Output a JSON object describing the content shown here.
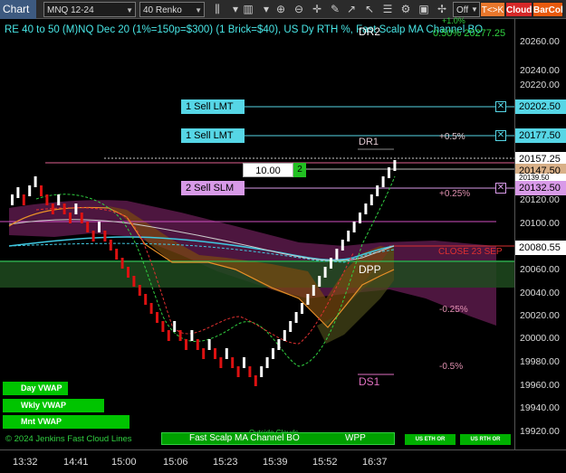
{
  "toolbar": {
    "chart_tab": "Chart",
    "instrument": "MNQ 12-24",
    "bar_type": "40 Renko",
    "toggle_off": "Off",
    "tk_button": "T<>K",
    "cloud_button": "Cloud",
    "barcol_button": "BarCol",
    "icons": [
      "bars-icon",
      "dropdown-icon",
      "zoom-in-icon",
      "zoom-out-icon",
      "crosshair-icon",
      "draw-pen-icon",
      "arrow-icon",
      "list-icon",
      "strategy-icon",
      "settings-icon"
    ]
  },
  "header": {
    "text": "RE 40 to 50 (M)NQ Dec 20 (1%=150p=$300) (1 Brick=$40), US Dy RTH %, Fast Scalp MA Channel BO",
    "dr2_label": "DR2",
    "top_right_pct": "0.50% 20277.25",
    "top_right_pct_small": "+1.0%"
  },
  "orders": {
    "sell_lmt_1": "1 Sell LMT",
    "sell_lmt_1_price": "20202.50",
    "sell_lmt_2": "1 Sell LMT",
    "sell_lmt_2_price": "20177.50",
    "sell_slm": "2 Sell SLM",
    "sell_slm_price": "20132.50",
    "qty_value": "10.00",
    "qty_count": "2"
  },
  "levels": {
    "dr1": "DR1",
    "plus_half_pct": "+0.5%",
    "plus_quarter_pct": "+0.25%",
    "close_label": "CLOSE 23 SEP",
    "dpp": "DPP",
    "minus_quarter_pct": "-0.25%",
    "minus_half_pct": "-0.5%",
    "ds1": "DS1"
  },
  "price_boxes": {
    "last": "20157.25",
    "entry": "20147.50",
    "hidden": "20139.50",
    "close": "20080.55"
  },
  "yaxis": [
    "20260.00",
    "20240.00",
    "20220.00",
    "20160.00",
    "20120.00",
    "20100.00",
    "20060.00",
    "20040.00",
    "20020.00",
    "20000.00",
    "19980.00",
    "19960.00",
    "19940.00",
    "19920.00"
  ],
  "xaxis": [
    "13:32",
    "14:41",
    "15:00",
    "15:06",
    "15:23",
    "15:39",
    "15:52",
    "16:37"
  ],
  "buttons": {
    "day_vwap": "Day VWAP",
    "wkly_vwap": "Wkly VWAP",
    "mnt_vwap": "Mnt VWAP",
    "fast_scalp": "Fast Scalp MA Channel BO",
    "wpp": "WPP",
    "us_eth_or": "US ETH OR",
    "us_rth_or": "US RTH OR",
    "outside_clouds": "Outside Clouds"
  },
  "copyright": "© 2024 Jenkins Fast Cloud Lines",
  "colors": {
    "up_bar": "#ffffff",
    "down_bar": "#dd1111",
    "order_line": "#56d6e6",
    "slm_line": "#d89ae8",
    "accent_green": "#00c400"
  }
}
